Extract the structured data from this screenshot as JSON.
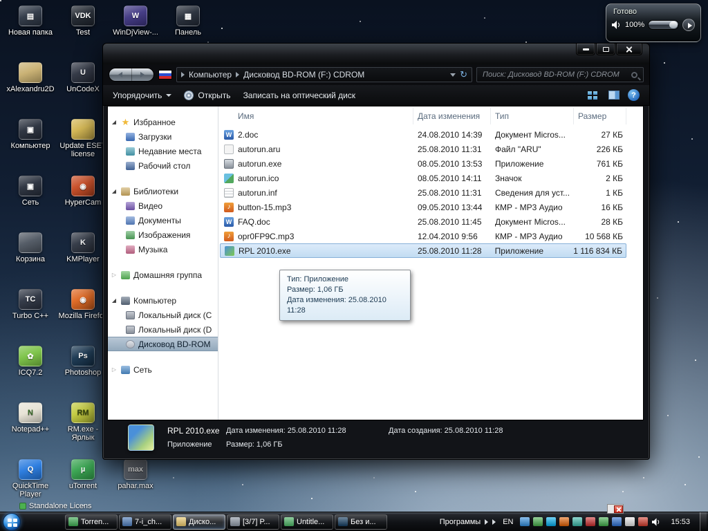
{
  "icons": {
    "star_glyph": "★",
    "expanded_glyph": "◢",
    "collapsed_glyph": "▷",
    "mp3_glyph": "♪",
    "doc_glyph": "W",
    "refresh_glyph": "↻"
  },
  "volume_popup": {
    "title": "Готово",
    "level": "100%"
  },
  "desktop": {
    "partial_icon_label": "Standalone Licens",
    "icons": [
      {
        "name": "new-folder",
        "label": "Новая папка",
        "col": 0,
        "row": 0,
        "color": "#2b3442",
        "glyph": "▤"
      },
      {
        "name": "test",
        "label": "Test",
        "col": 1,
        "row": 0,
        "color": "#1d232c",
        "glyph": "VDK"
      },
      {
        "name": "windjview",
        "label": "WinDjView-...",
        "col": 2,
        "row": 0,
        "color": "#3d3480",
        "glyph": "W"
      },
      {
        "name": "panel",
        "label": "Панель",
        "col": 3,
        "row": 0,
        "color": "#232a36",
        "glyph": "▦"
      },
      {
        "name": "xalexandru2d",
        "label": "xAlexandru2D",
        "col": 0,
        "row": 1,
        "color": "#c7ae6e",
        "glyph": "",
        "fg": "#4a3a1a"
      },
      {
        "name": "uncodex",
        "label": "UnCodeX",
        "col": 1,
        "row": 1,
        "color": "#2c3240",
        "glyph": "U"
      },
      {
        "name": "computer",
        "label": "Компьютер",
        "col": 0,
        "row": 2,
        "color": "#262d3a",
        "glyph": "▣"
      },
      {
        "name": "eset-license",
        "label": "Update ESET license",
        "col": 1,
        "row": 2,
        "color": "#d3b54e",
        "glyph": "",
        "fg": "#4a3a1a"
      },
      {
        "name": "network",
        "label": "Сеть",
        "col": 0,
        "row": 3,
        "color": "#262d3a",
        "glyph": "▣"
      },
      {
        "name": "hypercam",
        "label": "HyperCam",
        "col": 1,
        "row": 3,
        "color": "#c94a22",
        "glyph": "◉"
      },
      {
        "name": "recycle-bin",
        "label": "Корзина",
        "col": 0,
        "row": 4,
        "color": "#4d5560",
        "glyph": ""
      },
      {
        "name": "kmplayer",
        "label": "KMPlayer",
        "col": 1,
        "row": 4,
        "color": "#2e3542",
        "glyph": "K"
      },
      {
        "name": "turbo-c",
        "label": "Turbo C++",
        "col": 0,
        "row": 5,
        "color": "#2b3240",
        "glyph": "TC"
      },
      {
        "name": "firefox",
        "label": "Mozilla Firefox",
        "col": 1,
        "row": 5,
        "color": "#e0661e",
        "glyph": "◉"
      },
      {
        "name": "icq",
        "label": "ICQ7.2",
        "col": 0,
        "row": 6,
        "color": "#78c142",
        "glyph": "✿"
      },
      {
        "name": "photoshop",
        "label": "Photoshop",
        "col": 1,
        "row": 6,
        "color": "#16344f",
        "glyph": "Ps"
      },
      {
        "name": "notepad-plus",
        "label": "Notepad++",
        "col": 0,
        "row": 7,
        "color": "#e6e2d4",
        "glyph": "N",
        "fg": "#3a6a2a"
      },
      {
        "name": "rm-shortcut",
        "label": "RM.exe - Ярлык",
        "col": 1,
        "row": 7,
        "color": "#c2ca3a",
        "glyph": "RM",
        "fg": "#3a4a10"
      },
      {
        "name": "quicktime",
        "label": "QuickTime Player",
        "col": 0,
        "row": 8,
        "color": "#2478de",
        "glyph": "Q"
      },
      {
        "name": "utorrent",
        "label": "uTorrent",
        "col": 1,
        "row": 8,
        "color": "#33a24c",
        "glyph": "µ"
      },
      {
        "name": "pahar-max",
        "label": "pahar.max",
        "col": 2,
        "row": 8,
        "color": "#646b76",
        "glyph": "max"
      }
    ]
  },
  "window": {
    "breadcrumb": {
      "root": "Компьютер",
      "current": "Дисковод BD-ROM (F:) CDROM"
    },
    "search_text": "Поиск: Дисковод BD-ROM (F:) CDROM",
    "toolbar": {
      "organize": "Упорядочить",
      "open": "Открыть",
      "burn": "Записать на оптический диск",
      "help": "?"
    },
    "sidebar": {
      "sections": [
        {
          "name": "favorites",
          "label": "Избранное",
          "icon": "star",
          "expanded": true,
          "items": [
            {
              "name": "downloads",
              "label": "Загрузки",
              "icon": "downloads"
            },
            {
              "name": "recent-places",
              "label": "Недавние места",
              "icon": "recent"
            },
            {
              "name": "desktop",
              "label": "Рабочий стол",
              "icon": "desktop"
            }
          ]
        },
        {
          "name": "libraries",
          "label": "Библиотеки",
          "icon": "libraries",
          "expanded": true,
          "items": [
            {
              "name": "video",
              "label": "Видео",
              "icon": "video"
            },
            {
              "name": "documents",
              "label": "Документы",
              "icon": "docs"
            },
            {
              "name": "pictures",
              "label": "Изображения",
              "icon": "pics"
            },
            {
              "name": "music",
              "label": "Музыка",
              "icon": "music"
            }
          ]
        },
        {
          "name": "homegroup",
          "label": "Домашняя группа",
          "icon": "homegroup",
          "expanded": false,
          "items": []
        },
        {
          "name": "computer",
          "label": "Компьютер",
          "icon": "computer",
          "expanded": true,
          "items": [
            {
              "name": "local-disk-c",
              "label": "Локальный диск (C",
              "icon": "disk"
            },
            {
              "name": "local-disk-d",
              "label": "Локальный диск (D",
              "icon": "disk"
            },
            {
              "name": "bd-rom-drive",
              "label": "Дисковод BD-ROM",
              "icon": "disc",
              "selected": true
            }
          ]
        },
        {
          "name": "network",
          "label": "Сеть",
          "icon": "network",
          "expanded": false,
          "items": []
        }
      ]
    },
    "file_list": {
      "columns": [
        "Имя",
        "Дата изменения",
        "Тип",
        "Размер"
      ],
      "rows": [
        {
          "name": "2.doc",
          "date": "24.08.2010 14:39",
          "type": "Документ Micros...",
          "size": "27 КБ",
          "icon": "doc"
        },
        {
          "name": "autorun.aru",
          "date": "25.08.2010 11:31",
          "type": "Файл \"ARU\"",
          "size": "226 КБ",
          "icon": "aru"
        },
        {
          "name": "autorun.exe",
          "date": "08.05.2010 13:53",
          "type": "Приложение",
          "size": "761 КБ",
          "icon": "app"
        },
        {
          "name": "autorun.ico",
          "date": "08.05.2010 14:11",
          "type": "Значок",
          "size": "2 КБ",
          "icon": "ico"
        },
        {
          "name": "autorun.inf",
          "date": "25.08.2010 11:31",
          "type": "Сведения для уст...",
          "size": "1 КБ",
          "icon": "inf"
        },
        {
          "name": "button-15.mp3",
          "date": "09.05.2010 13:44",
          "type": "КМР - MP3 Аудио",
          "size": "16 КБ",
          "icon": "mp3"
        },
        {
          "name": "FAQ.doc",
          "date": "25.08.2010 11:45",
          "type": "Документ Micros...",
          "size": "28 КБ",
          "icon": "doc"
        },
        {
          "name": "opr0FP9C.mp3",
          "date": "12.04.2010 9:56",
          "type": "КМР - MP3 Аудио",
          "size": "10 568 КБ",
          "icon": "mp3"
        },
        {
          "name": "RPL 2010.exe",
          "date": "25.08.2010 11:28",
          "type": "Приложение",
          "size": "1 116 834 КБ",
          "icon": "rpl",
          "selected": true
        }
      ]
    },
    "tooltip": {
      "lines": [
        "Тип: Приложение",
        "Размер: 1,06 ГБ",
        "Дата изменения: 25.08.2010 11:28"
      ]
    },
    "details": {
      "file_name": "RPL 2010.exe",
      "modified": "Дата изменения: 25.08.2010 11:28",
      "created": "Дата создания: 25.08.2010 11:28",
      "type": "Приложение",
      "size": "Размер: 1,06 ГБ"
    }
  },
  "taskbar": {
    "items": [
      {
        "label": "Torren...",
        "color": "#3aa84e",
        "active": false
      },
      {
        "label": "7-i_ch...",
        "color": "#4a7ab8",
        "active": false
      },
      {
        "label": "Диско...",
        "color": "#e8c76a",
        "active": true
      },
      {
        "label": "[3/7] P...",
        "color": "#8a94a2",
        "active": false
      },
      {
        "label": "Untitle...",
        "color": "#48b060",
        "active": false
      },
      {
        "label": "Без и...",
        "color": "#123a5e",
        "active": false
      }
    ],
    "programs_label": "Программы",
    "language": "EN",
    "clock": "15:53",
    "tray_icons": [
      {
        "color": "#2e8de0"
      },
      {
        "color": "#45b049"
      },
      {
        "color": "#00aff0"
      },
      {
        "color": "#e66000"
      },
      {
        "color": "#37b8a8"
      },
      {
        "color": "#cc2a2a"
      },
      {
        "color": "#3fae49"
      },
      {
        "color": "#2a6fd4"
      },
      {
        "color": "#e8e8e8"
      },
      {
        "color": "#d43a2a"
      }
    ]
  }
}
